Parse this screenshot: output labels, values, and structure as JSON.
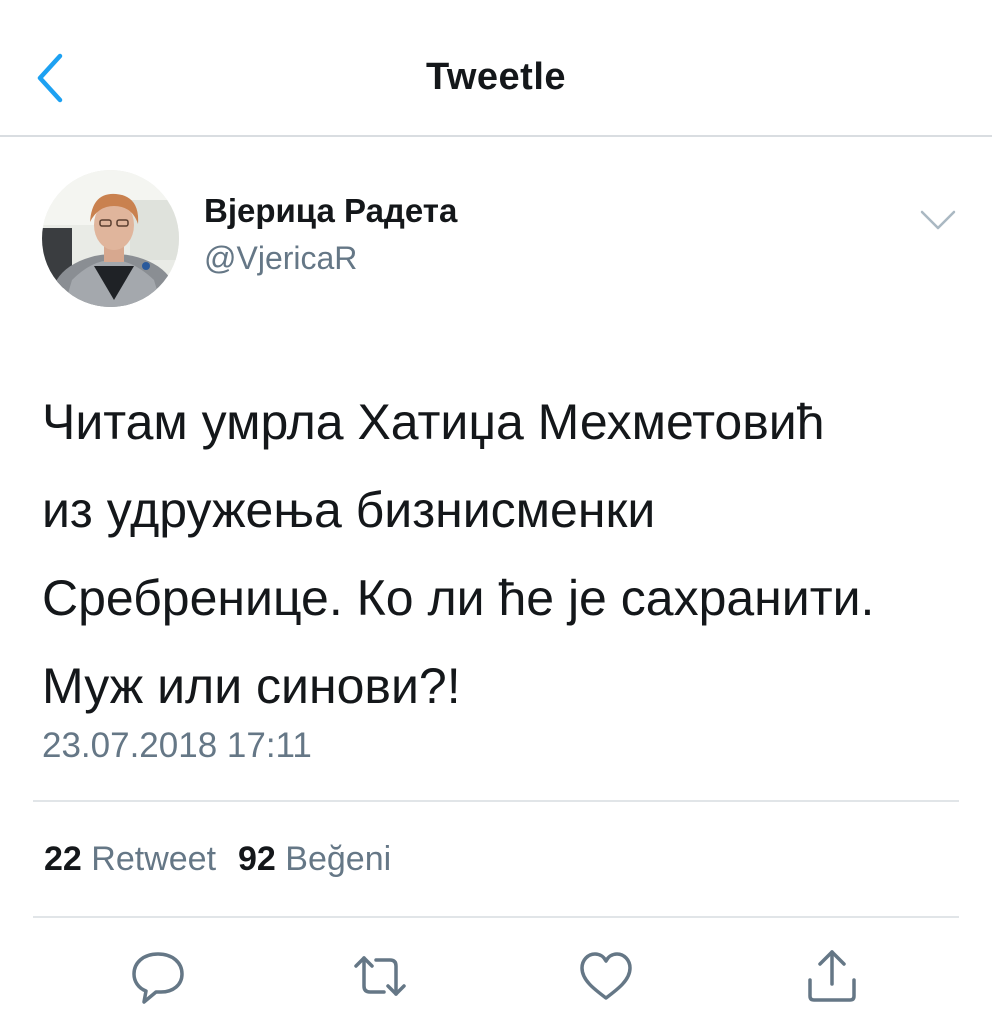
{
  "header": {
    "title": "Tweetle",
    "back_icon": "chevron-left-icon"
  },
  "author": {
    "name": "Вјерица Радета",
    "handle": "@VjericaR",
    "avatar": "profile-photo"
  },
  "tweet": {
    "lines": [
      "Читам умрла Хатиџа Мехметовић",
      "из удружења бизнисменки",
      "Сребренице. Ко ли ће је сахранити.",
      "Муж или синови?!"
    ],
    "timestamp": "23.07.2018 17:11"
  },
  "stats": {
    "retweets_count": "22",
    "retweets_label": "Retweet",
    "likes_count": "92",
    "likes_label": "Beğeni"
  },
  "actions": {
    "reply_icon": "reply-icon",
    "retweet_icon": "retweet-icon",
    "like_icon": "heart-icon",
    "share_icon": "share-icon"
  },
  "colors": {
    "accent": "#1da1f2",
    "primary_text": "#14171a",
    "secondary_text": "#657786",
    "divider": "#e1e5e8"
  }
}
